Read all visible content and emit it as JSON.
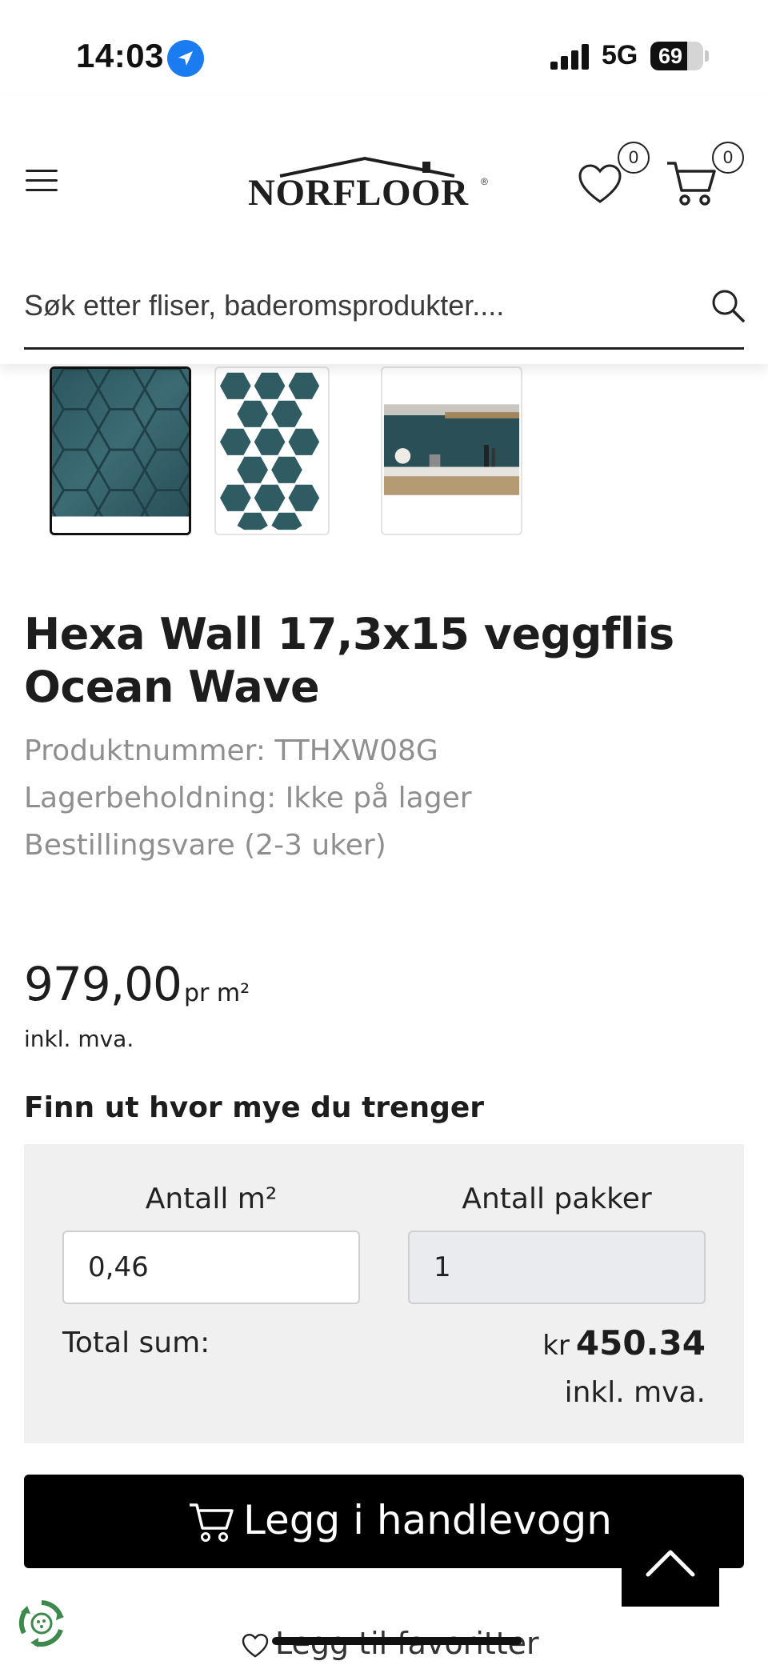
{
  "status_bar": {
    "time": "14:03",
    "network": "5G",
    "battery": "69",
    "battery_level": 0.69
  },
  "header": {
    "logo_text": "NORFLOOR",
    "logo_mark": "®",
    "favorites_count": "0",
    "cart_count": "0",
    "search_placeholder": "Søk etter fliser, baderomsprodukter...."
  },
  "gallery": {
    "thumbnails": [
      "hexagon-tile-closeup",
      "hexagon-tile-sheet",
      "kitchen-backsplash-photo"
    ],
    "active_index": 0
  },
  "product": {
    "title": "Hexa Wall 17,3x15 veggflis Ocean Wave",
    "product_number": "Produktnummer: TTHXW08G",
    "stock": "Lagerbeholdning: Ikke på lager",
    "delivery": "Bestillingsvare (2-3 uker)",
    "price": "979,00",
    "price_unit": "pr m²",
    "price_vat": "inkl. mva."
  },
  "calculator": {
    "heading": "Finn ut hvor mye du trenger",
    "area_label": "Antall m²",
    "area_value": "0,46",
    "packages_label": "Antall pakker",
    "packages_value": "1",
    "total_label": "Total sum:",
    "total_currency": "kr",
    "total_amount": "450.34",
    "total_vat": "inkl. mva."
  },
  "actions": {
    "add_to_cart": "Legg i handlevogn",
    "add_to_favorites": "Legg til favoritter"
  },
  "colors": {
    "tile": "#2f5b63",
    "button": "#000000",
    "calc_background": "#f0f0f0",
    "meta_text": "#8f8f8f",
    "location_icon": "#1a7cf0"
  },
  "icons": {
    "menu": "menu-icon",
    "favorites": "heart-icon",
    "cart": "cart-icon",
    "search": "search-icon",
    "scroll_top": "chevron-up-icon",
    "eco": "recycle-icon"
  }
}
